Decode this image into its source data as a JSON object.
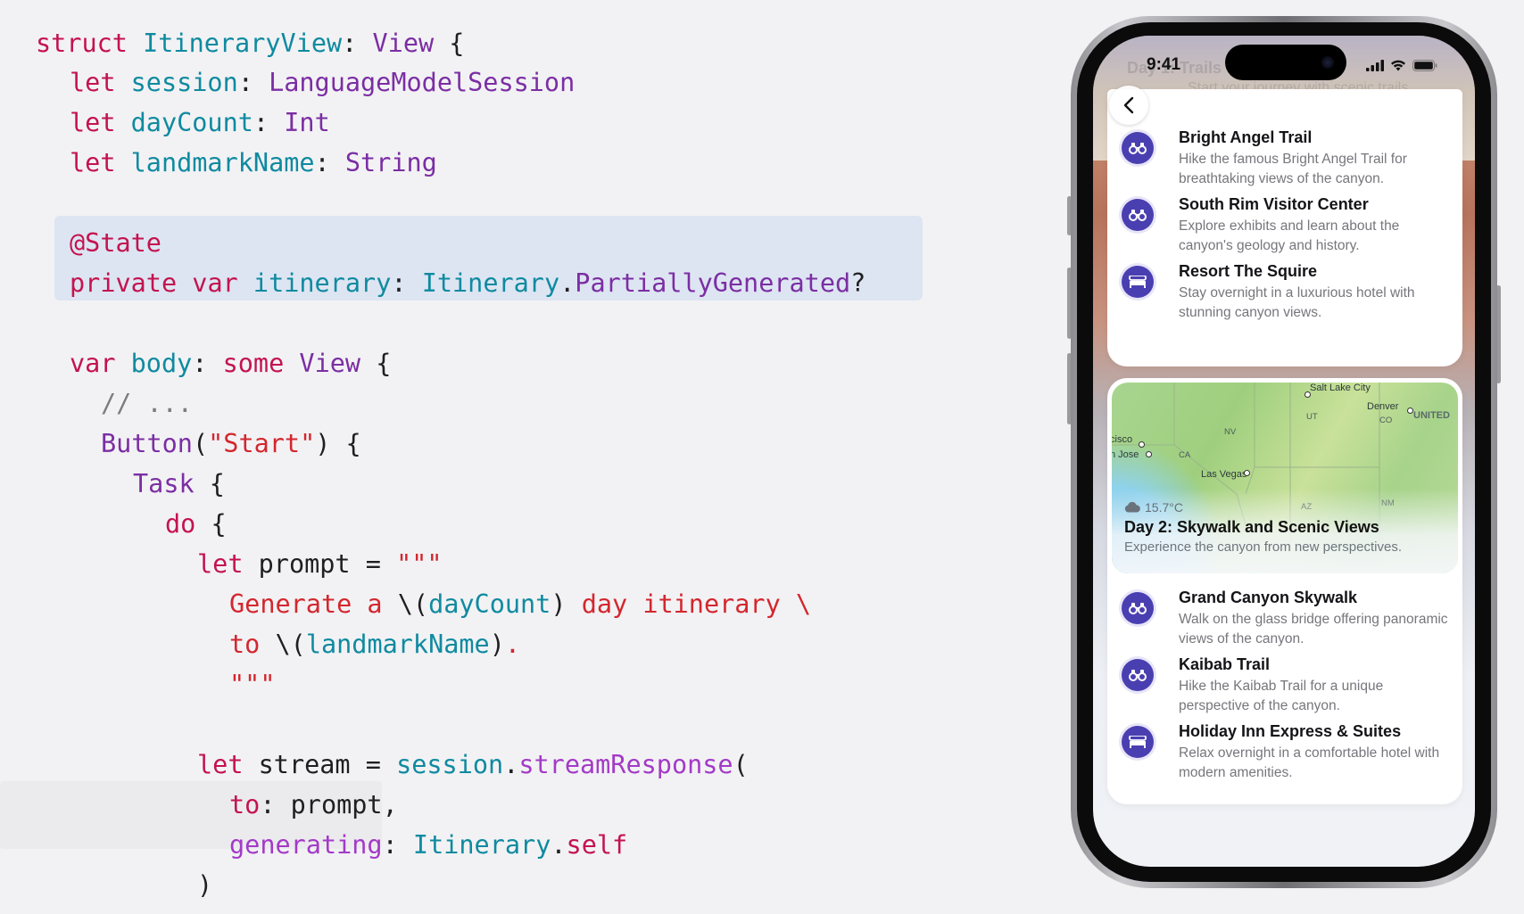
{
  "code_lines": [
    [
      [
        "kw",
        "struct "
      ],
      [
        "id",
        "ItineraryView"
      ],
      [
        "pl",
        ": "
      ],
      [
        "ty",
        "View"
      ],
      [
        "pl",
        " {"
      ]
    ],
    [
      [
        "kw",
        "let "
      ],
      [
        "id",
        "session"
      ],
      [
        "pl",
        ": "
      ],
      [
        "ty",
        "LanguageModelSession"
      ]
    ],
    [
      [
        "kw",
        "let "
      ],
      [
        "id",
        "dayCount"
      ],
      [
        "pl",
        ": "
      ],
      [
        "ty",
        "Int"
      ]
    ],
    [
      [
        "kw",
        "let "
      ],
      [
        "id",
        "landmarkName"
      ],
      [
        "pl",
        ": "
      ],
      [
        "ty",
        "String"
      ]
    ],
    [
      [
        "kw",
        "@State"
      ]
    ],
    [
      [
        "kw",
        "private "
      ],
      [
        "kw",
        "var "
      ],
      [
        "id",
        "itinerary"
      ],
      [
        "pl",
        ": "
      ],
      [
        "id",
        "Itinerary"
      ],
      [
        "pl",
        "."
      ],
      [
        "ty",
        "PartiallyGenerated"
      ],
      [
        "pl",
        "?"
      ]
    ],
    [
      [
        "kw",
        "var "
      ],
      [
        "id",
        "body"
      ],
      [
        "pl",
        ": "
      ],
      [
        "kw",
        "some "
      ],
      [
        "ty",
        "View"
      ],
      [
        "pl",
        " {"
      ]
    ],
    [
      [
        "cm",
        "// ..."
      ]
    ],
    [
      [
        "ty",
        "Button"
      ],
      [
        "pl",
        "("
      ],
      [
        "str",
        "\"Start\""
      ],
      [
        "pl",
        ") {"
      ]
    ],
    [
      [
        "ty",
        "Task"
      ],
      [
        "pl",
        " {"
      ]
    ],
    [
      [
        "kw",
        "do"
      ],
      [
        "pl",
        " {"
      ]
    ],
    [
      [
        "kw",
        "let "
      ],
      [
        "pl",
        "prompt = "
      ],
      [
        "str",
        "\"\"\""
      ]
    ],
    [
      [
        "str",
        "Generate a "
      ],
      [
        "pl",
        "\\("
      ],
      [
        "id",
        "dayCount"
      ],
      [
        "pl",
        ") "
      ],
      [
        "str",
        "day itinerary \\"
      ]
    ],
    [
      [
        "str",
        "to "
      ],
      [
        "pl",
        "\\("
      ],
      [
        "id",
        "landmarkName"
      ],
      [
        "pl",
        ")"
      ],
      [
        "str",
        "."
      ]
    ],
    [
      [
        "str",
        "\"\"\""
      ]
    ],
    [
      [
        "kw",
        "let "
      ],
      [
        "pl",
        "stream = "
      ],
      [
        "id",
        "session"
      ],
      [
        "pl",
        "."
      ],
      [
        "mt",
        "streamResponse"
      ],
      [
        "pl",
        "("
      ]
    ],
    [
      [
        "kw",
        "to"
      ],
      [
        "pl",
        ": prompt,"
      ]
    ],
    [
      [
        "mt",
        "generating"
      ],
      [
        "pl",
        ": "
      ],
      [
        "id",
        "Itinerary"
      ],
      [
        "pl",
        "."
      ],
      [
        "kw",
        "self"
      ]
    ],
    [
      [
        "pl",
        ")"
      ]
    ]
  ],
  "phone": {
    "status": {
      "time": "9:41"
    },
    "hero": {
      "title": "Day 1: Trails",
      "subtitle": "Start your journey with scenic trails and inspiring views."
    },
    "day1_activities": [
      {
        "icon": "binoculars-icon",
        "title": "Bright Angel Trail",
        "description": "Hike the famous Bright Angel Trail for breathtaking views of the canyon."
      },
      {
        "icon": "binoculars-icon",
        "title": "South Rim Visitor Center",
        "description": "Explore exhibits and learn about the canyon's geology and history."
      },
      {
        "icon": "bed-icon",
        "title": "Resort The Squire",
        "description": "Stay overnight in a luxurious hotel with stunning canyon views."
      }
    ],
    "day2": {
      "map_labels": [
        "Salt Lake City",
        "Denver",
        "UNITED",
        "UT",
        "CO",
        "NV",
        "CA",
        "cisco",
        "n Jose",
        "Las Vegas",
        "AZ",
        "NM"
      ],
      "weather": "15.7°C",
      "title": "Day 2: Skywalk and Scenic Views",
      "subtitle": "Experience the canyon from new perspectives.",
      "activities": [
        {
          "icon": "binoculars-icon",
          "title": "Grand Canyon Skywalk",
          "description": "Walk on the glass bridge offering panoramic views of the canyon."
        },
        {
          "icon": "binoculars-icon",
          "title": "Kaibab Trail",
          "description": "Hike the Kaibab Trail for a unique perspective of the canyon."
        },
        {
          "icon": "bed-icon",
          "title": "Holiday Inn Express & Suites",
          "description": "Relax overnight in a comfortable hotel with modern amenities."
        }
      ]
    }
  }
}
